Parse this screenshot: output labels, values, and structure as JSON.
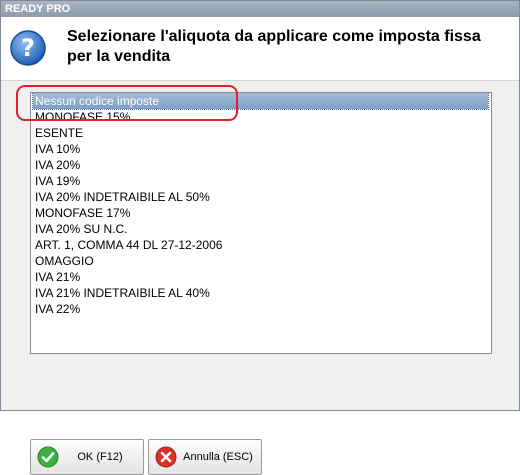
{
  "window": {
    "title": "READY PRO"
  },
  "dialog": {
    "message": "Selezionare l'aliquota da applicare come imposta fissa per la vendita",
    "icon": "question-icon"
  },
  "list": {
    "selected_index": 0,
    "items": [
      "Nessun codice imposte",
      "MONOFASE 15%",
      "ESENTE",
      "IVA 10%",
      "IVA 20%",
      "IVA 19%",
      "IVA 20% INDETRAIBILE AL 50%",
      "MONOFASE 17%",
      "IVA 20% SU N.C.",
      "ART. 1, COMMA 44 DL 27-12-2006",
      "OMAGGIO",
      "IVA 21%",
      "IVA 21% INDETRAIBILE AL 40%",
      "IVA 22%"
    ]
  },
  "buttons": {
    "ok_label": "OK (F12)",
    "cancel_label": "Annulla (ESC)"
  },
  "colors": {
    "selection": "#8faad0",
    "highlight_ring": "#e0202a",
    "ok_green": "#3cb043",
    "cancel_red": "#d8322a"
  }
}
